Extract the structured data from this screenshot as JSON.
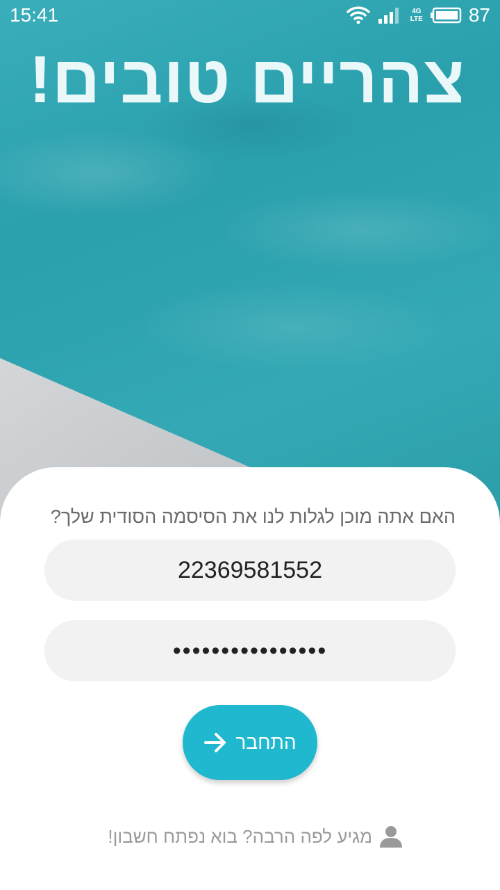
{
  "status_bar": {
    "time": "15:41",
    "network": "4G",
    "network_sub": "LTE",
    "battery": "87"
  },
  "header": {
    "greeting": "צהריים טובים!"
  },
  "login": {
    "question": "האם אתה מוכן לגלות לנו את הסיסמה הסודית שלך?",
    "username_value": "22369581552",
    "password_value": "••••••••••••••••",
    "button_label": "התחבר",
    "signup_text": "מגיע לפה הרבה? בוא נפתח חשבון!"
  },
  "colors": {
    "accent": "#1fb8cf",
    "water": "#2ea3b0",
    "field_bg": "#f2f2f2"
  }
}
